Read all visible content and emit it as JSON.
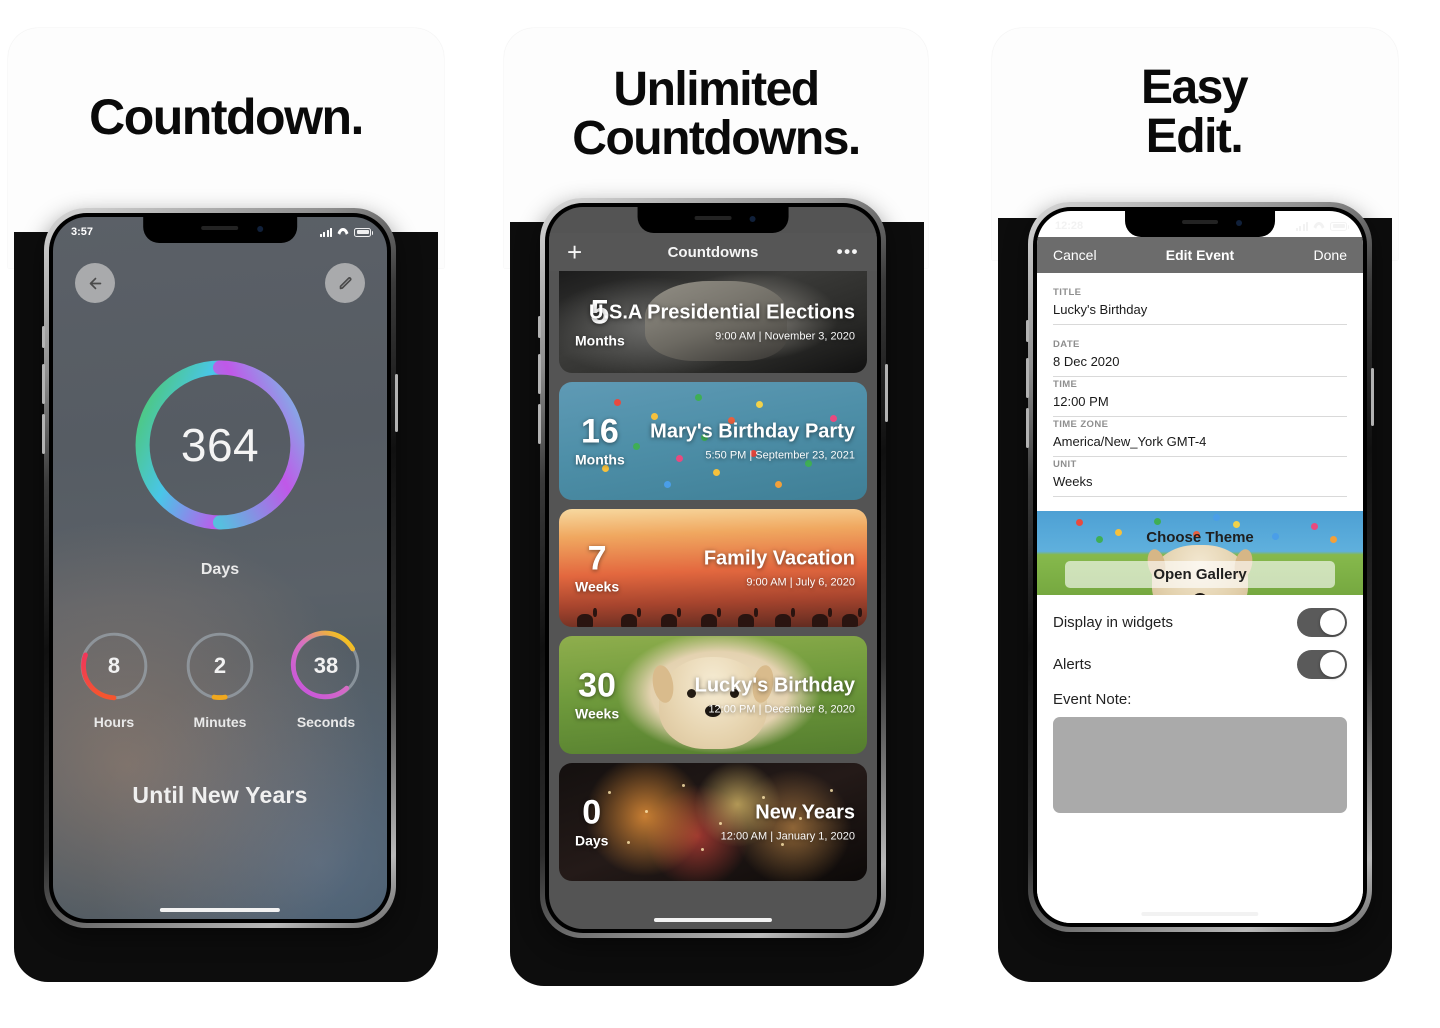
{
  "panels": [
    {
      "headline": "Countdown.",
      "status": {
        "time": "3:57"
      },
      "nav": {
        "back_icon": "arrow-left-icon",
        "edit_icon": "pencil-icon"
      },
      "detail": {
        "main_value": "364",
        "main_label": "Days",
        "sub_rings": [
          {
            "value": "8",
            "label": "Hours"
          },
          {
            "value": "2",
            "label": "Minutes"
          },
          {
            "value": "38",
            "label": "Seconds"
          }
        ],
        "footer": "Until New Years"
      }
    },
    {
      "headline_line1": "Unlimited",
      "headline_line2": "Countdowns.",
      "status": {
        "time": ""
      },
      "nav": {
        "add_label": "+",
        "title": "Countdowns",
        "more_label": "•••"
      },
      "events": [
        {
          "value": "5",
          "unit": "Months",
          "title": "U.S.A Presidential Elections",
          "meta": "9:00 AM | November 3, 2020",
          "theme": "rushmore"
        },
        {
          "value": "16",
          "unit": "Months",
          "title": "Mary's Birthday Party",
          "meta": "5:50 PM | September 23, 2021",
          "theme": "confetti"
        },
        {
          "value": "7",
          "unit": "Weeks",
          "title": "Family Vacation",
          "meta": "9:00 AM | July 6, 2020",
          "theme": "desert"
        },
        {
          "value": "30",
          "unit": "Weeks",
          "title": "Lucky's Birthday",
          "meta": "12:00 PM | December 8, 2020",
          "theme": "puppy"
        },
        {
          "value": "0",
          "unit": "Days",
          "title": "New Years",
          "meta": "12:00 AM | January 1, 2020",
          "theme": "fireworks"
        }
      ]
    },
    {
      "headline_line1": "Easy",
      "headline_line2": "Edit.",
      "status": {
        "time": "12:28"
      },
      "nav": {
        "cancel": "Cancel",
        "title": "Edit Event",
        "done": "Done"
      },
      "form": {
        "fields": [
          {
            "label": "TITLE",
            "value": "Lucky's Birthday"
          },
          {
            "label": "DATE",
            "value": "8 Dec 2020"
          },
          {
            "label": "TIME",
            "value": "12:00 PM"
          },
          {
            "label": "TIME ZONE",
            "value": "America/New_York GMT-4"
          },
          {
            "label": "UNIT",
            "value": "Weeks"
          }
        ],
        "choose_theme": "Choose Theme",
        "open_gallery": "Open Gallery",
        "toggles": [
          {
            "label": "Display in widgets",
            "on": true
          },
          {
            "label": "Alerts",
            "on": true
          }
        ],
        "note_label": "Event Note:",
        "note_value": ""
      }
    }
  ],
  "colors": {
    "ring_green": "#4ec86f",
    "ring_cyan": "#49c6e8",
    "ring_purple": "#c058e8",
    "ring_magenta": "#d24fe0",
    "hours_red": "#f0375a",
    "hours_orange": "#f4552f",
    "minutes_orange": "#f0a81e",
    "seconds_purple": "#c450e0",
    "seconds_yellow": "#f5c518",
    "track": "#9aa3ab",
    "switch_on": "#5a5a5a",
    "note_bg": "#aaaaaa"
  }
}
